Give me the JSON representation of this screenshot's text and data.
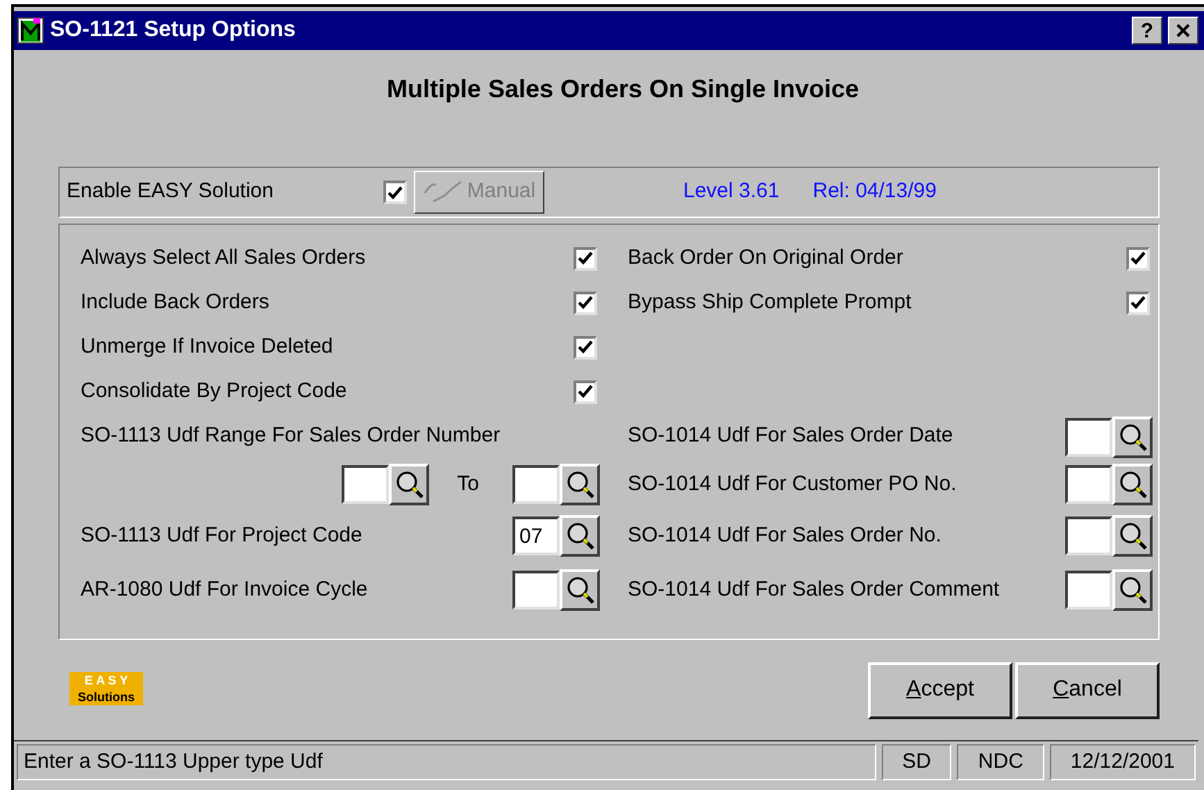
{
  "window": {
    "title": "SO-1121 Setup Options"
  },
  "help_button": "?",
  "heading": "Multiple Sales Orders On Single Invoice",
  "easy": {
    "label": "Enable EASY Solution",
    "checked": true,
    "manual_button": {
      "label": "Manual",
      "disabled": true
    },
    "version": "Level 3.61",
    "release": "Rel: 04/13/99"
  },
  "options_left": [
    {
      "label": "Always Select All Sales Orders",
      "checked": true
    },
    {
      "label": "Include Back Orders",
      "checked": true
    },
    {
      "label": "Unmerge If Invoice Deleted",
      "checked": true
    },
    {
      "label": "Consolidate By Project Code",
      "checked": true
    }
  ],
  "options_right": [
    {
      "label": "Back Order On Original Order",
      "checked": true
    },
    {
      "label": "Bypass Ship Complete Prompt",
      "checked": true
    }
  ],
  "udf_range": {
    "label": "SO-1113 Udf Range For Sales Order Number",
    "to_label": "To"
  },
  "lookups_left": [
    {
      "label": "SO-1113 Udf For Project Code",
      "value": "07"
    },
    {
      "label": "AR-1080 Udf For Invoice Cycle"
    }
  ],
  "lookups_right": [
    {
      "label": "SO-1014 Udf For Sales Order Date"
    },
    {
      "label": "SO-1014 Udf For Customer PO No."
    },
    {
      "label": "SO-1014 Udf For Sales Order No."
    },
    {
      "label": "SO-1014 Udf For Sales Order Comment"
    }
  ],
  "logo": {
    "top": "E A S Y",
    "bottom": "Solutions"
  },
  "buttons": [
    {
      "label": "Accept"
    },
    {
      "label": "Cancel"
    }
  ],
  "status_bar": {
    "message": "Enter a SO-1113 Upper type Udf",
    "sections": [
      "SD",
      "NDC",
      "12/12/2001"
    ]
  }
}
